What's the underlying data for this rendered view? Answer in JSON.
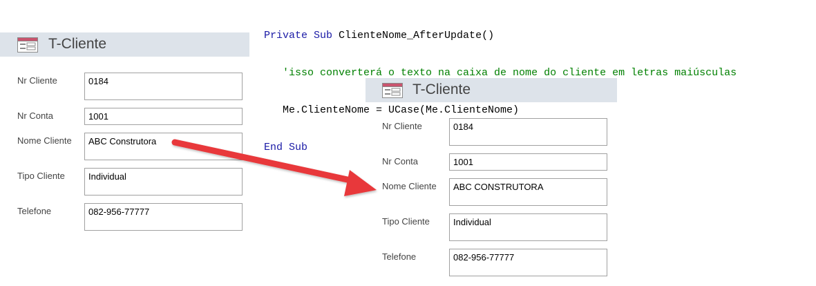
{
  "code": {
    "lines": [
      {
        "parts": [
          {
            "t": "kw",
            "v": "Private Sub "
          },
          {
            "t": "plain",
            "v": "ClienteNome_AfterUpdate()"
          }
        ]
      },
      {
        "parts": [
          {
            "t": "cmt",
            "v": "   'isso converterá o texto na caixa de nome do cliente em letras maiúsculas"
          }
        ]
      },
      {
        "parts": [
          {
            "t": "plain",
            "v": "   Me.ClienteNome = UCase(Me.ClienteNome)"
          }
        ]
      },
      {
        "parts": [
          {
            "t": "kw",
            "v": "End Sub"
          }
        ]
      }
    ]
  },
  "form_before": {
    "title": "T-Cliente",
    "fields": [
      {
        "label": "Nr Cliente",
        "value": "0184"
      },
      {
        "label": "Nr Conta",
        "value": "1001"
      },
      {
        "label": "Nome Cliente",
        "value": "ABC Construtora"
      },
      {
        "label": "Tipo Cliente",
        "value": "Individual"
      },
      {
        "label": "Telefone",
        "value": "082-956-77777"
      }
    ]
  },
  "form_after": {
    "title": "T-Cliente",
    "fields": [
      {
        "label": "Nr Cliente",
        "value": "0184"
      },
      {
        "label": "Nr Conta",
        "value": "1001"
      },
      {
        "label": "Nome Cliente",
        "value": "ABC CONSTRUTORA"
      },
      {
        "label": "Tipo Cliente",
        "value": "Individual"
      },
      {
        "label": "Telefone",
        "value": "082-956-77777"
      }
    ]
  },
  "colors": {
    "keyword": "#1a1aa6",
    "comment": "#008000",
    "header_bg": "#dde3ea",
    "arrow": "#e8393a"
  }
}
